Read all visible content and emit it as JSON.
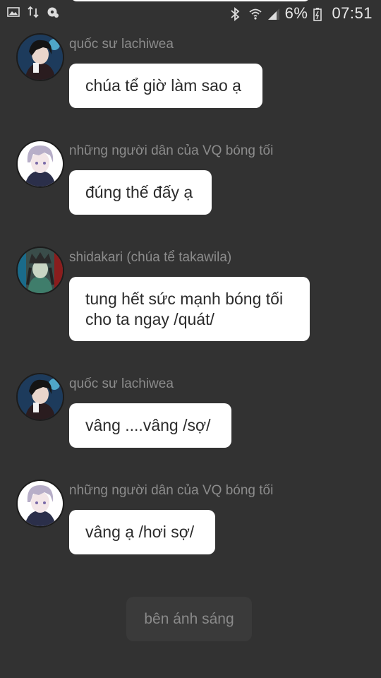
{
  "status_bar": {
    "battery_percent": "6%",
    "time": "07:51",
    "left_icons": [
      "image-icon",
      "data-transfer-icon",
      "sync-settings-icon"
    ],
    "right_icons": [
      "bluetooth-icon",
      "wifi-icon",
      "signal-icon",
      "battery-icon"
    ]
  },
  "messages": [
    {
      "sender": "quốc sư lachiwea",
      "lines": [
        "chúa tể giờ làm sao ạ"
      ],
      "avatar": "dark-haired-avatar"
    },
    {
      "sender": "những người dân của VQ bóng tối",
      "lines": [
        "đúng thế đấy ạ"
      ],
      "avatar": "silver-haired-avatar"
    },
    {
      "sender": "shidakari (chúa tể takawila)",
      "lines": [
        "tung hết sức mạnh bóng tối",
        "cho ta ngay /quát/"
      ],
      "avatar": "crowned-avatar"
    },
    {
      "sender": "quốc sư lachiwea",
      "lines": [
        "vâng ....vâng /sợ/"
      ],
      "avatar": "dark-haired-avatar"
    },
    {
      "sender": "những người dân của VQ bóng tối",
      "lines": [
        "vâng ạ /hơi sợ/"
      ],
      "avatar": "silver-haired-avatar"
    }
  ],
  "choice_button": {
    "label": "bên ánh sáng"
  },
  "colors": {
    "background": "#323232",
    "bubble": "#ffffff",
    "sender_text": "#8c8c8c"
  }
}
